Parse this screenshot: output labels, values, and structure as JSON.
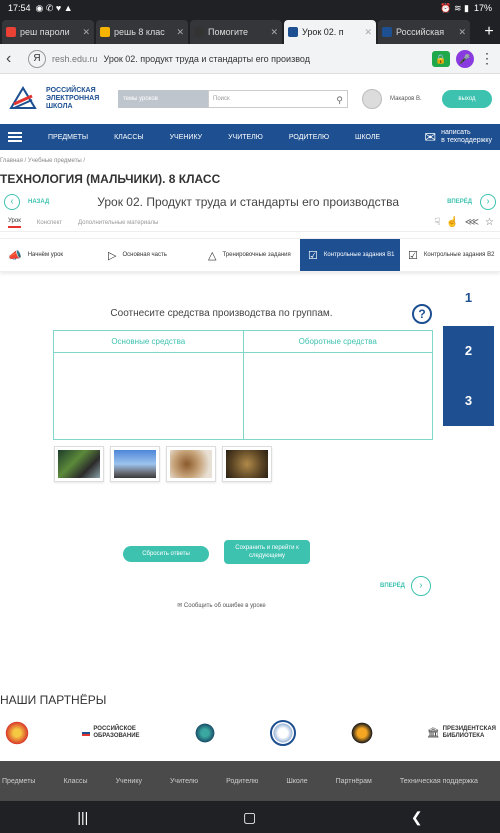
{
  "status": {
    "time": "17:54",
    "battery": "17%"
  },
  "tabs": [
    {
      "label": "реш пароли",
      "fav_color": "#e94235",
      "active": false
    },
    {
      "label": "решь 8 клас",
      "fav_color": "#f4b400",
      "active": false
    },
    {
      "label": "Помогите",
      "fav_color": "#333333",
      "active": false
    },
    {
      "label": "Урок 02. п",
      "fav_color": "#1d4f91",
      "active": true
    },
    {
      "label": "Российская",
      "fav_color": "#1d4f91",
      "active": false
    }
  ],
  "browser": {
    "domain": "resh.edu.ru",
    "page_title": "Урок 02. продукт труда и стандарты его производ",
    "yandex_letter": "Я"
  },
  "header": {
    "logo_line1": "РОССИЙСКАЯ",
    "logo_line2": "ЭЛЕКТРОННАЯ",
    "logo_line3": "ШКОЛА",
    "search_scope": "темы уроков",
    "search_placeholder": "Поиск",
    "user_name": "Макаров В.",
    "exit_label": "выход"
  },
  "nav": {
    "items": [
      "ПРЕДМЕТЫ",
      "КЛАССЫ",
      "УЧЕНИКУ",
      "УЧИТЕЛЮ",
      "РОДИТЕЛЮ",
      "ШКОЛЕ"
    ],
    "write_line1": "написать",
    "write_line2": "в техподдержку"
  },
  "breadcrumb": {
    "home": "Главная",
    "sep": "/",
    "subjects": "Учебные предметы",
    "sep2": "/"
  },
  "course_title": "ТЕХНОЛОГИЯ (МАЛЬЧИКИ). 8 КЛАСС",
  "lesson": {
    "back_label": "НАЗАД",
    "forward_label": "ВПЕРЁД",
    "title": "Урок 02. Продукт труда и стандарты его производства"
  },
  "subtabs": [
    "Урок",
    "Конспект",
    "Дополнительные материалы"
  ],
  "steps": [
    {
      "label": "Начнём урок",
      "active": false
    },
    {
      "label": "Основная часть",
      "active": false
    },
    {
      "label": "Тренировочные задания",
      "active": false
    },
    {
      "label": "Контрольные задания В1",
      "active": true
    },
    {
      "label": "Контрольные задания В2",
      "active": false
    }
  ],
  "task": {
    "question": "Соотнесите средства производства по группам.",
    "help": "?",
    "group1": "Основные средства",
    "group2": "Оборотные средства",
    "reset_label": "Сбросить ответы",
    "save_label": "Сохранить и перейти к следующему",
    "forward_label": "ВПЕРЁД",
    "report_label": "Сообщить об ошибке в уроке"
  },
  "task_numbers": [
    "1",
    "2",
    "3"
  ],
  "partners": {
    "title": "НАШИ ПАРТНЁРЫ",
    "rus_obr_line1": "РОССИЙСКОЕ",
    "rus_obr_line2": "ОБРАЗОВАНИЕ",
    "library_line1": "ПРЕЗИДЕНТСКАЯ",
    "library_line2": "БИБЛИОТЕКА"
  },
  "footer": [
    "Предметы",
    "Классы",
    "Ученику",
    "Учителю",
    "Родителю",
    "Школе",
    "Партнёрам",
    "Техническая поддержка"
  ]
}
